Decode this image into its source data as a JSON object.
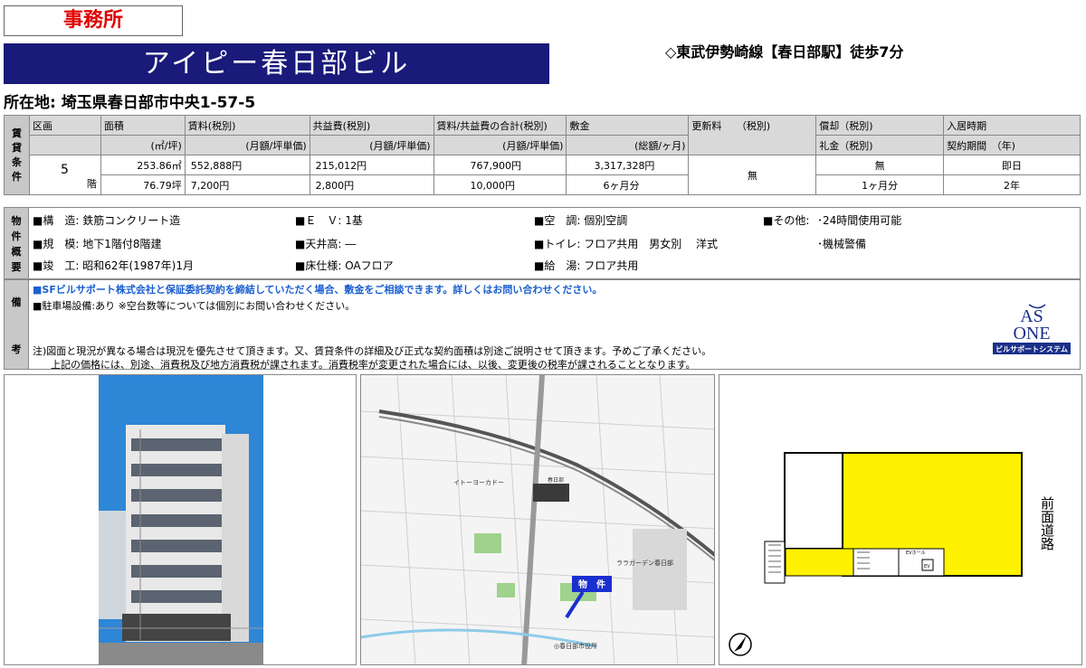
{
  "type_label": "事務所",
  "building_name": "アイピー春日部ビル",
  "access": "◇東武伊勢崎線【春日部駅】徒歩7分",
  "address": "所在地: 埼玉県春日部市中央1-57-5",
  "rental": {
    "side_label": [
      "賃",
      "貸",
      "条",
      "件"
    ],
    "headers": {
      "section": "区画",
      "area": "面積",
      "rent": "賃料(税別)",
      "common": "共益費(税別)",
      "total": "賃料/共益費の合計(税別)",
      "deposit": "敷金",
      "renewal": "更新料　　（税別)",
      "amortization": "償却（税別)",
      "move_in": "入居時期"
    },
    "subheaders": {
      "area": "(㎡/坪)",
      "rent": "(月額/坪単価)",
      "common": "(月額/坪単価)",
      "total": "(月額/坪単価)",
      "deposit": "(総額/ヶ月)",
      "key_money": "礼金（税別)",
      "contract": "契約期間　（年)"
    },
    "row": {
      "floor_number": "5",
      "floor_suffix": "階",
      "area_sqm": "253.86㎡",
      "area_tsubo": "76.79坪",
      "rent_monthly": "552,888円",
      "rent_tsubo": "7,200円",
      "common_monthly": "215,012円",
      "common_tsubo": "2,800円",
      "total_monthly": "767,900円",
      "total_tsubo": "10,000円",
      "deposit_total": "3,317,328円",
      "deposit_months": "6ヶ月分",
      "renewal": "無",
      "amortization": "無",
      "key_money": "1ヶ月分",
      "move_in": "即日",
      "contract_years": "2年"
    }
  },
  "overview": {
    "side_label": [
      "物",
      "件",
      "概",
      "要"
    ],
    "structure": "■構　造: 鉄筋コンクリート造",
    "scale": "■規　模: 地下1階付8階建",
    "built": "■竣　工: 昭和62年(1987年)1月",
    "ev": "■Ｅ　Ｖ: 1基",
    "ceiling": "■天井高: ―",
    "floor": "■床仕様: OAフロア",
    "aircon": "■空　調: 個別空調",
    "toilet": "■トイレ: フロア共用　男女別　 洋式",
    "water": "■給　湯: フロア共用",
    "other_label": "■その他:",
    "other_1": "･24時間使用可能",
    "other_2": "･機械警備"
  },
  "remarks": {
    "side_label": [
      "備",
      "考"
    ],
    "guarantee": "■SFビルサポート株式会社と保証委託契約を締結していただく場合、敷金をご相談できます。詳しくはお問い合わせください。",
    "parking": "■駐車場設備:あり ※空台数等については個別にお問い合わせください。",
    "note_1": "注)図面と現況が異なる場合は現況を優先させて頂きます。又、賃貸条件の詳細及び正式な契約面積は別途ご説明させて頂きます。予めご了承ください。",
    "note_2": "上記の価格には、別途、消費税及び地方消費税が課されます。消費税率が変更された場合には、以後、変更後の税率が課されることとなります。"
  },
  "logo": {
    "line1": "AS",
    "line2": "ONE",
    "tagline": "ビルサポートシステム"
  },
  "map": {
    "label_property": "物　件",
    "label_ito": "イトーヨーカドー",
    "label_lala": "ララガーデン春日部",
    "label_cityhall": "◎春日部市役所",
    "label_station": "春日部"
  },
  "floorplan": {
    "road_label": "前面道路",
    "ev_label": "EVホール",
    "ev": "EV"
  },
  "colors": {
    "title_bg": "#1a1a7a",
    "type_text": "#e00000",
    "remark_blue": "#1a5fd0",
    "office_yellow": "#fff200"
  }
}
